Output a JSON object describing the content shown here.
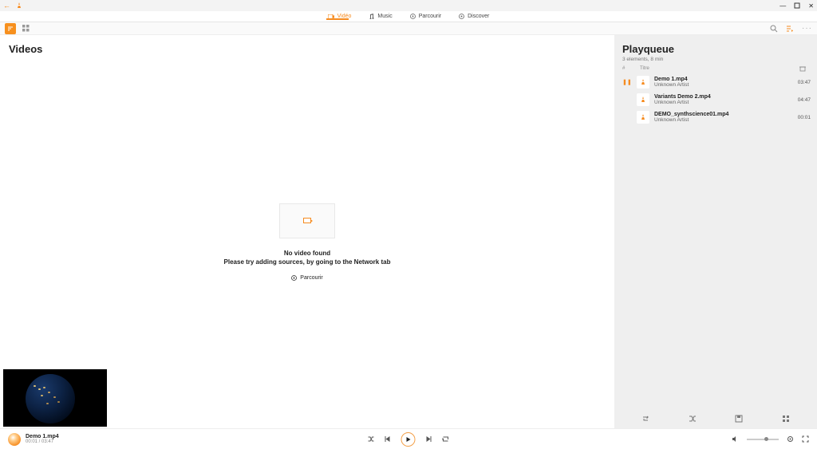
{
  "window": {
    "title": "VLC"
  },
  "nav": {
    "tabs": [
      {
        "label": "Vidéo",
        "active": true
      },
      {
        "label": "Music",
        "active": false
      },
      {
        "label": "Parcourir",
        "active": false
      },
      {
        "label": "Discover",
        "active": false
      }
    ]
  },
  "content": {
    "heading": "Videos",
    "empty_title": "No video found",
    "empty_subtitle": "Please try adding sources, by going to the Network tab",
    "browse_label": "Parcourir"
  },
  "playqueue": {
    "heading": "Playqueue",
    "meta": "3 elements, 8 min",
    "header_title": "Titre",
    "items": [
      {
        "title": "Demo 1.mp4",
        "artist": "Unknown Artist",
        "duration": "03:47",
        "now_playing": true
      },
      {
        "title": "Variants Demo 2.mp4",
        "artist": "Unknown Artist",
        "duration": "04:47",
        "now_playing": false
      },
      {
        "title": "DEMO_synthscience01.mp4",
        "artist": "Unknown Artist",
        "duration": "00:01",
        "now_playing": false
      }
    ]
  },
  "player": {
    "title": "Demo 1.mp4",
    "position": "00:01 / 03:47"
  },
  "colors": {
    "accent": "#f68b1f"
  }
}
